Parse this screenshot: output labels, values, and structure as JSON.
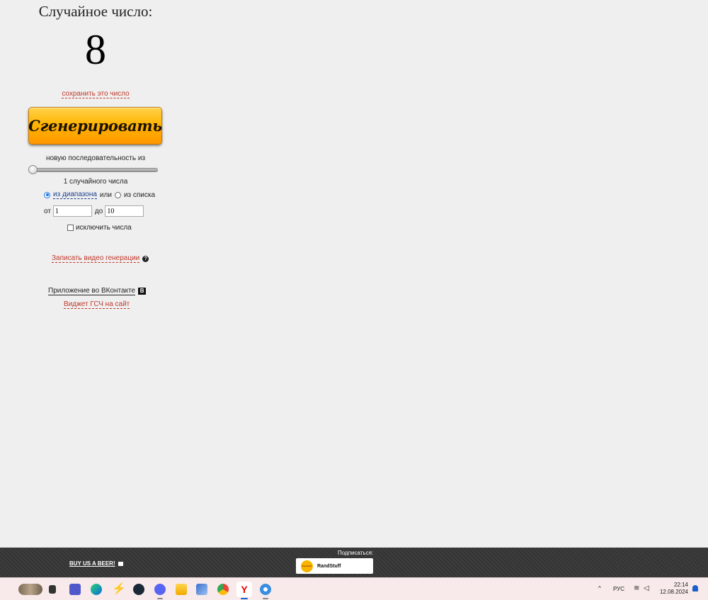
{
  "generator": {
    "title": "Случайное число:",
    "result": "8",
    "save_link": "сохранить это число",
    "generate_button": "Сгенерировать",
    "sequence_label": "новую последовательность из",
    "slider_value": 1,
    "count_label": "1 случайного числа",
    "mode": {
      "range_label": "из диапазона",
      "or_label": "или",
      "list_label": "из списка",
      "selected": "range"
    },
    "range": {
      "from_label": "от",
      "from_value": "1",
      "to_label": "до",
      "to_value": "10"
    },
    "exclude_label": "исключить числа",
    "video_link": "Записать видео генерации",
    "vk_app": "Приложение во ВКонтакте",
    "vk_icon_letter": "В",
    "widget_link": "Виджет ГСЧ на сайт"
  },
  "footer": {
    "beer_link": "BUY US A BEER!",
    "subscribe_label": "Подписаться:",
    "subscribe_name": "RandStuff",
    "subscribe_logo_text": "RandStuff"
  },
  "taskbar": {
    "language": "РУС",
    "time": "22:14",
    "date": "12.08.2024",
    "icons": [
      "widgets-icon",
      "task-view-icon",
      "teams-icon",
      "edge-icon",
      "bolt-icon",
      "steam-icon",
      "discord-icon",
      "file-explorer-icon",
      "editor-icon",
      "chrome-icon",
      "yandex-browser-icon",
      "settings-gear-icon"
    ]
  }
}
